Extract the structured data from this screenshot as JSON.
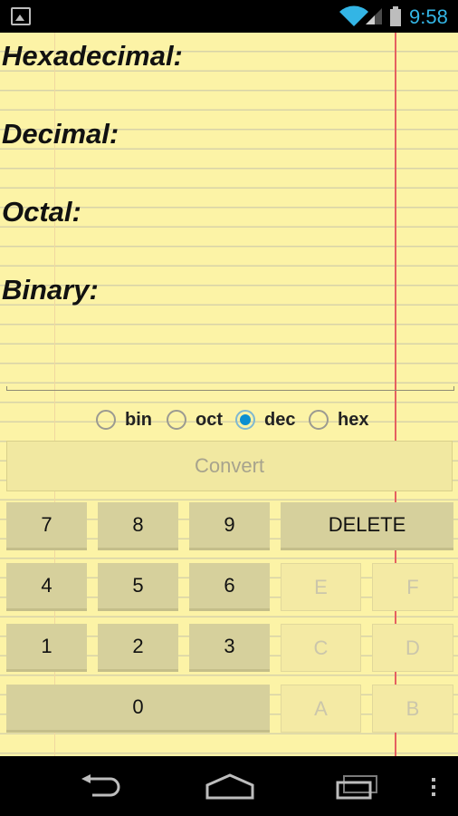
{
  "status": {
    "time": "9:58",
    "accent_color": "#33b5e5",
    "icons": [
      "image-notification-icon",
      "wifi-icon",
      "cell-signal-icon",
      "battery-icon"
    ]
  },
  "labels": {
    "hexadecimal": "Hexadecimal:",
    "decimal": "Decimal:",
    "octal": "Octal:",
    "binary": "Binary:"
  },
  "values": {
    "hexadecimal": "",
    "decimal": "",
    "octal": "",
    "binary": ""
  },
  "input": {
    "value": ""
  },
  "radios": [
    {
      "label": "bin",
      "checked": false
    },
    {
      "label": "oct",
      "checked": false
    },
    {
      "label": "dec",
      "checked": true
    },
    {
      "label": "hex",
      "checked": false
    }
  ],
  "convert_label": "Convert",
  "keys": {
    "k7": "7",
    "k8": "8",
    "k9": "9",
    "delete": "DELETE",
    "k4": "4",
    "k5": "5",
    "k6": "6",
    "kE": "E",
    "kF": "F",
    "k1": "1",
    "k2": "2",
    "k3": "3",
    "kC": "C",
    "kD": "D",
    "k0": "0",
    "kA": "A",
    "kB": "B"
  },
  "colors": {
    "paper": "#fcf3a6",
    "red_margin": "#e56060",
    "key_active": "#d6d09c",
    "radio_selected": "#0b8fd0"
  },
  "navbar": {
    "icons": [
      "back-icon",
      "home-icon",
      "recent-apps-icon",
      "overflow-menu-icon"
    ]
  }
}
